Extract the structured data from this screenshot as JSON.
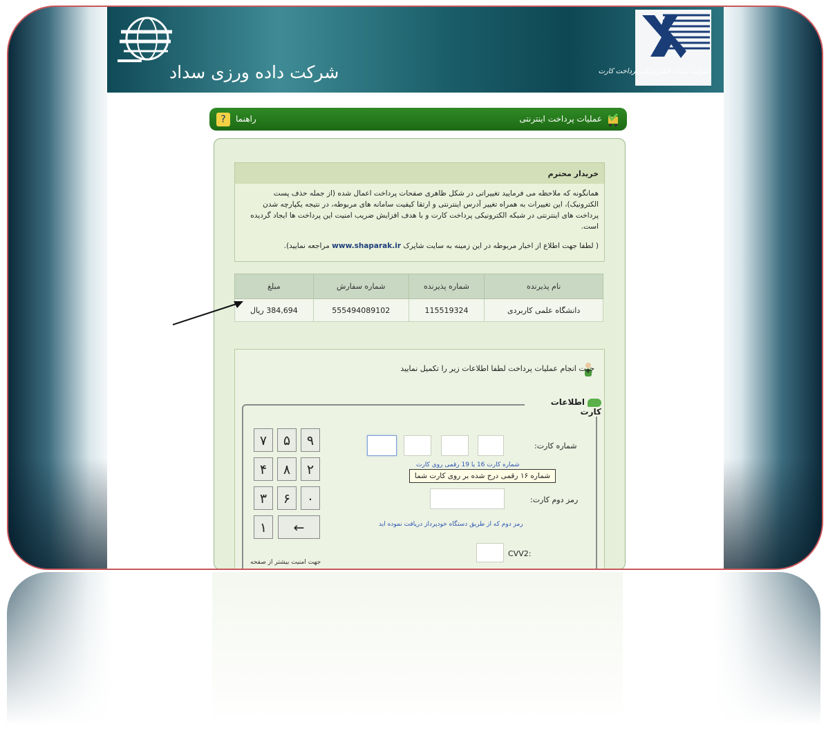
{
  "header": {
    "company_left": "شرکت داده ورزی سداد",
    "company_right": "شرکت شبکه الکترونیکی پرداخت کارت"
  },
  "toolbar": {
    "title": "عملیات پرداخت اینترنتی",
    "help_label": "راهنما"
  },
  "notice": {
    "heading": "خریدار محترم",
    "body": "همانگونه که ملاحظه می فرمایید تغییراتی در شکل ظاهری صفحات پرداخت اعمال شده (از جمله حذف پست الکترونیک)، این تغییرات به همراه تغییر آدرس اینترنتی و ارتقا کیفیت سامانه های مربوطه، در نتیجه یکپارچه شدن پرداخت های اینترنتی در شبکه الکترونیکی پرداخت کارت و با هدف افزایش ضریب امنیت این پرداخت ها ایجاد گردیده است.",
    "footer_pre": "( لطفا جهت اطلاع از اخبار مربوطه در این زمینه به سایت شاپرک",
    "footer_link": "www.shaparak.ir",
    "footer_post": "مراجعه نمایید)."
  },
  "merchant_table": {
    "headers": [
      "نام پذیرنده",
      "شماره پذیرنده",
      "شماره سفارش",
      "مبلغ"
    ],
    "row": [
      "دانشگاه علمی کاربردی",
      "115519324",
      "555494089102",
      "384,694 ریال"
    ]
  },
  "form": {
    "instruction": "جهت انجام عملیات پرداخت لطفا اطلاعات زیر را تکمیل نمایید",
    "legend": "اطلاعات کارت",
    "card_number_label": "شماره کارت:",
    "card_number_hint": "شماره کارت 16 یا 19 رقمی روی کارت",
    "tooltip": "شماره ۱۶ رقمی درج شده بر روی کارت شما",
    "pin2_label": "رمز دوم کارت:",
    "pin2_hint": "رمز دوم که از طریق دستگاه خودپرداز دریافت نموده اید",
    "cvv2_label": ":CVV2",
    "keypad_note": "جهت امنیت بیشتر از صفحه"
  },
  "keypad": {
    "keys": [
      "۹",
      "۵",
      "۷",
      "۲",
      "۸",
      "۴",
      "۰",
      "۶",
      "۳",
      "←",
      "۱"
    ]
  },
  "colors": {
    "header_teal": "#1a5e69",
    "green_bar": "#1d6a14",
    "panel_bg": "#e6efda",
    "frame_border": "#c9565a"
  }
}
